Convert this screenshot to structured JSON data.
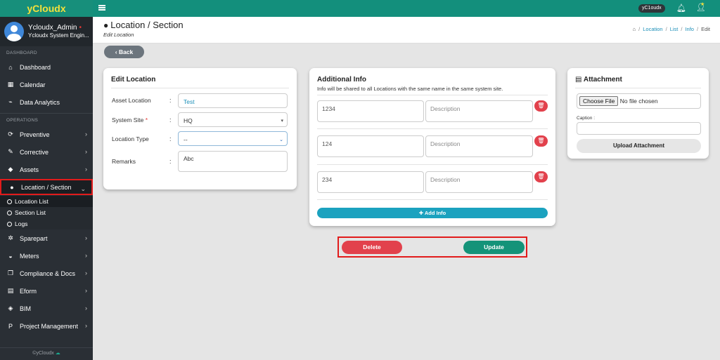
{
  "app": {
    "brand": "yCloudx"
  },
  "topbar": {
    "badge": "yC1oudx"
  },
  "user": {
    "name": "Ycloudx_Admin",
    "role": "Ycloudx System Engin..."
  },
  "sidebar": {
    "section_dashboard": "DASHBOARD",
    "section_operations": "OPERATIONS",
    "dashboard_items": [
      {
        "label": "Dashboard",
        "icon": "home-icon"
      },
      {
        "label": "Calendar",
        "icon": "calendar-icon"
      },
      {
        "label": "Data Analytics",
        "icon": "chart-icon"
      }
    ],
    "operations_items": [
      {
        "label": "Preventive",
        "icon": "refresh-icon"
      },
      {
        "label": "Corrective",
        "icon": "wrench-icon"
      },
      {
        "label": "Assets",
        "icon": "tag-icon"
      },
      {
        "label": "Location / Section",
        "icon": "globe-icon"
      }
    ],
    "sub_items": [
      "Location List",
      "Section List",
      "Logs"
    ],
    "more_items": [
      {
        "label": "Sparepart",
        "icon": "gears-icon"
      },
      {
        "label": "Meters",
        "icon": "gauge-icon"
      },
      {
        "label": "Compliance & Docs",
        "icon": "copy-icon"
      },
      {
        "label": "Eform",
        "icon": "file-icon"
      },
      {
        "label": "BIM",
        "icon": "cube-icon"
      },
      {
        "label": "Project Management",
        "icon": "project-icon"
      }
    ],
    "footer": "©yCloudx"
  },
  "header": {
    "title": "Location / Section",
    "subtitle": "Edit Location",
    "breadcrumb": [
      "Location",
      "List",
      "Info",
      "Edit"
    ]
  },
  "back_label": "Back",
  "edit_location": {
    "title": "Edit Location",
    "fields": {
      "asset_location_label": "Asset Location",
      "asset_location_value": "Test",
      "system_site_label": "System Site",
      "system_site_value": "HQ",
      "location_type_label": "Location Type",
      "location_type_value": "--",
      "remarks_label": "Remarks",
      "remarks_value": "Abc"
    },
    "colon": ":",
    "required_mark": "*"
  },
  "additional_info": {
    "title": "Additional Info",
    "note": "Info will be shared to all Locations with the same name in the same system site.",
    "rows": [
      {
        "value": "1234",
        "description_placeholder": "Description"
      },
      {
        "value": "124",
        "description_placeholder": "Description"
      },
      {
        "value": "234",
        "description_placeholder": "Description"
      }
    ],
    "add_label": "Add Info"
  },
  "attachment": {
    "title": "Attachment",
    "choose_label": "Choose File",
    "no_file": "No file chosen",
    "caption_label": "Caption :",
    "upload_label": "Upload Attachment"
  },
  "actions": {
    "delete": "Delete",
    "update": "Update"
  },
  "colors": {
    "teal": "#138f7c",
    "sidebar": "#2a2f35",
    "highlight": "#e21b1b",
    "danger": "#e2414c",
    "info": "#1ba2bf"
  }
}
